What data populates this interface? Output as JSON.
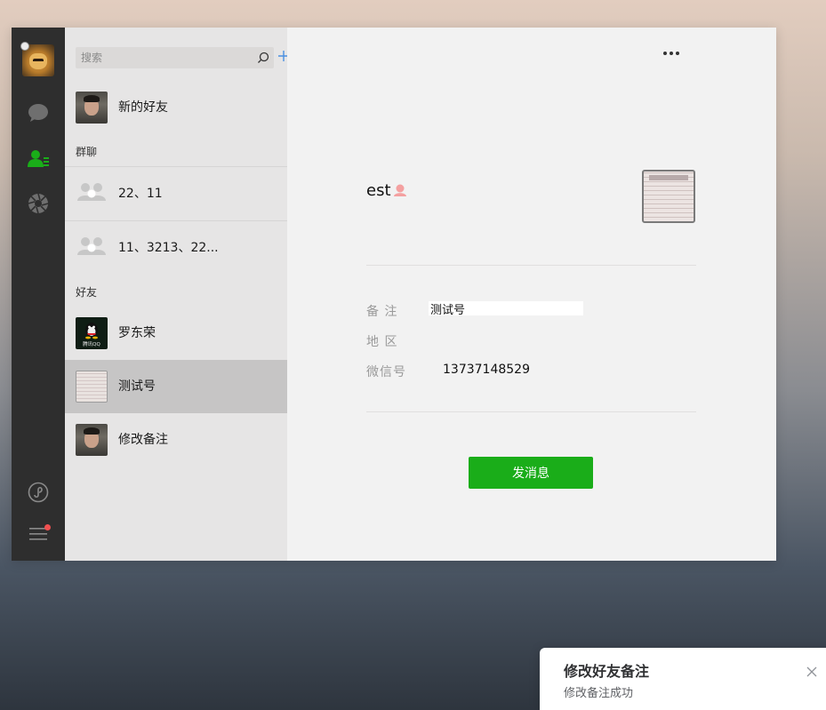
{
  "sidebar_nav": {
    "icons": [
      "chat-icon",
      "contacts-icon",
      "moments-icon",
      "mini-program-icon",
      "menu-icon"
    ],
    "accent_color": "#1aad19"
  },
  "contact_list": {
    "search_placeholder": "搜索",
    "new_friends": "新的好友",
    "group_section": "群聊",
    "groups": [
      "22、11",
      "11、3213、22..."
    ],
    "friends_section": "好友",
    "friends": [
      "罗东荣",
      "测试号",
      "修改备注"
    ],
    "qq_avatar_text": "腾讯QQ",
    "selected": "测试号"
  },
  "profile": {
    "nickname": "est",
    "gender": "female",
    "remark_label": "备 注",
    "remark_value": "测试号",
    "region_label": "地 区",
    "region_value": "",
    "wechat_id_label": "微信号",
    "wechat_id_value": "13737148529",
    "send_button": "发消息"
  },
  "toast": {
    "title": "修改好友备注",
    "message": "修改备注成功"
  }
}
